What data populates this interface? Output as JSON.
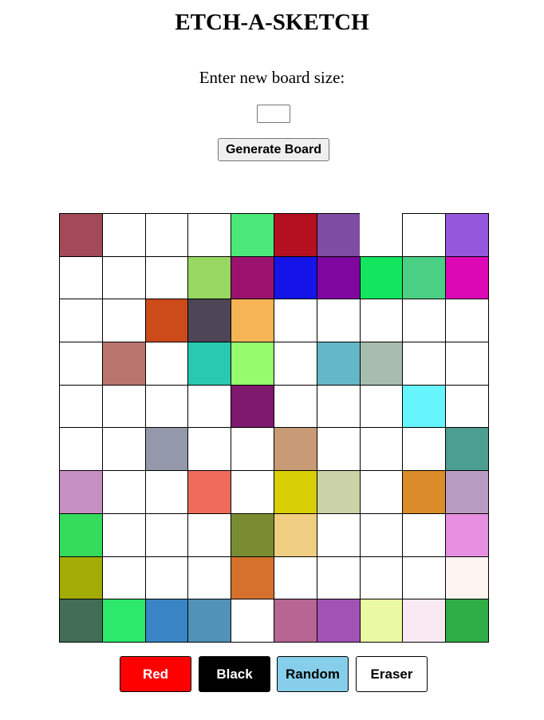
{
  "header": {
    "title": "ETCH-A-SKETCH",
    "prompt": "Enter new board size:"
  },
  "size_input": {
    "value": ""
  },
  "generate_button": {
    "label": "Generate Board"
  },
  "board": {
    "rows": 10,
    "cols": 10,
    "cells": [
      [
        "#a34a58",
        "#ffffff",
        "#ffffff",
        "#ffffff",
        "#4ce87a",
        "#b5101f",
        "#7e4ca3",
        "empty",
        "#ffffff",
        "#9458dd"
      ],
      [
        "#ffffff",
        "#ffffff",
        "#ffffff",
        "#98d862",
        "#9a126e",
        "#1414e8",
        "#7f069e",
        "#12e65e",
        "#4acf84",
        "#dc08b6"
      ],
      [
        "#ffffff",
        "#ffffff",
        "#cd4a1a",
        "#4e4557",
        "#f7b454",
        "#ffffff",
        "#ffffff",
        "#ffffff",
        "#ffffff",
        "#ffffff"
      ],
      [
        "#ffffff",
        "#bb756f",
        "#ffffff",
        "#28c9b0",
        "#97fb6e",
        "#ffffff",
        "#63b7c6",
        "#a8bdb0",
        "#ffffff",
        "#ffffff"
      ],
      [
        "#ffffff",
        "#ffffff",
        "#ffffff",
        "#ffffff",
        "#7f196d",
        "#ffffff",
        "#ffffff",
        "#ffffff",
        "#66f5fc",
        "#ffffff"
      ],
      [
        "#ffffff",
        "#ffffff",
        "#9399ab",
        "#ffffff",
        "#ffffff",
        "#c89a75",
        "#ffffff",
        "#ffffff",
        "#ffffff",
        "#4c9e91"
      ],
      [
        "#c690c2",
        "#ffffff",
        "#ffffff",
        "#ee6b5b",
        "#ffffff",
        "#d8cf06",
        "#cbd2a8",
        "#ffffff",
        "#dc8b2a",
        "#b99cc1"
      ],
      [
        "#35db5a",
        "#ffffff",
        "#ffffff",
        "#ffffff",
        "#7a8c32",
        "#f0ce81",
        "#ffffff",
        "#ffffff",
        "#ffffff",
        "#e790e1"
      ],
      [
        "#a3ac06",
        "#ffffff",
        "#ffffff",
        "#ffffff",
        "#d5712c",
        "#ffffff",
        "#ffffff",
        "#ffffff",
        "#ffffff",
        "#fef4f1"
      ],
      [
        "#416e55",
        "#2ce96a",
        "#3884c5",
        "#5092b8",
        "#ffffff",
        "#b76593",
        "#a152b5",
        "#eafaa3",
        "#f8e9f3",
        "#2eae47"
      ]
    ]
  },
  "color_buttons": [
    {
      "label": "Red",
      "background": "#ff0000",
      "text_color": "#ffffff"
    },
    {
      "label": "Black",
      "background": "#000000",
      "text_color": "#ffffff"
    },
    {
      "label": "Random",
      "background": "#87ceeb",
      "text_color": "#000000"
    },
    {
      "label": "Eraser",
      "background": "#ffffff",
      "text_color": "#000000"
    }
  ]
}
